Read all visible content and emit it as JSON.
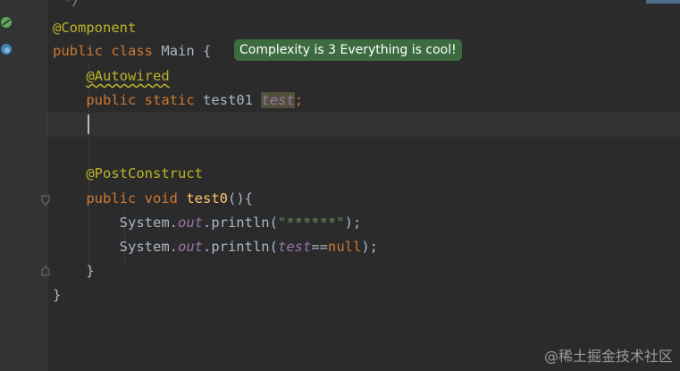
{
  "gutter": {
    "icons": [
      "spring-bean-icon",
      "web-globe-icon"
    ]
  },
  "code": {
    "prev_line_tail": "*/",
    "line1": {
      "annotation": "@Component"
    },
    "line2": {
      "kw1": "public",
      "kw2": "class",
      "class_name": "Main",
      "brace": "{"
    },
    "hint": "Complexity is 3 Everything is cool!",
    "line3": {
      "annotation": "@Autowired"
    },
    "line4": {
      "kw1": "public",
      "kw2": "static",
      "type": "test01",
      "field": "test",
      "semicolon": ";"
    },
    "line6": {
      "annotation": "@PostConstruct"
    },
    "line7": {
      "kw1": "public",
      "kw2": "void",
      "method": "test0",
      "rest": "(){"
    },
    "line8": {
      "obj": "System.",
      "field": "out",
      "call": ".println(",
      "string": "\"******\"",
      "end": ");"
    },
    "line9": {
      "obj": "System.",
      "field": "out",
      "call": ".println(",
      "field2": "test",
      "op": "==",
      "kw": "null",
      "end": ");"
    },
    "line10": {
      "brace": "}"
    },
    "line11": {
      "brace": "}"
    }
  },
  "watermark": "@稀土掘金技术社区"
}
